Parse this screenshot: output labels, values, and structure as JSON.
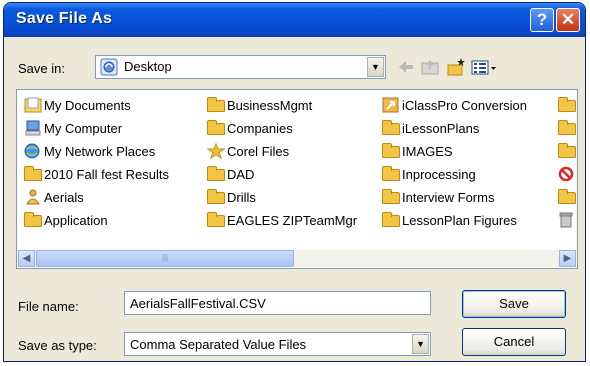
{
  "window": {
    "title": "Save File As",
    "help_glyph": "?",
    "close_glyph": "✕"
  },
  "save_in": {
    "label": "Save in:",
    "value": "Desktop"
  },
  "toolbar": {
    "back_icon": "back-arrow-icon",
    "up_icon": "up-folder-icon",
    "new_folder_icon": "new-folder-icon",
    "view_icon": "view-menu-icon"
  },
  "items": [
    {
      "name": "My Documents",
      "icon": "my-documents-icon"
    },
    {
      "name": "My Computer",
      "icon": "my-computer-icon"
    },
    {
      "name": "My Network Places",
      "icon": "network-places-icon"
    },
    {
      "name": "2010 Fall fest Results",
      "icon": "folder-icon"
    },
    {
      "name": "Aerials",
      "icon": "user-folder-icon"
    },
    {
      "name": "Application",
      "icon": "folder-icon"
    },
    {
      "name": "BusinessMgmt",
      "icon": "folder-icon"
    },
    {
      "name": "Companies",
      "icon": "folder-icon"
    },
    {
      "name": "Corel Files",
      "icon": "star-folder-icon"
    },
    {
      "name": "DAD",
      "icon": "folder-icon"
    },
    {
      "name": "Drills",
      "icon": "folder-icon"
    },
    {
      "name": "EAGLES ZIPTeamMgr",
      "icon": "folder-icon"
    },
    {
      "name": "iClassPro Conversion",
      "icon": "shortcut-icon"
    },
    {
      "name": "iLessonPlans",
      "icon": "folder-icon"
    },
    {
      "name": "IMAGES",
      "icon": "folder-icon"
    },
    {
      "name": "Inprocessing",
      "icon": "folder-icon"
    },
    {
      "name": "Interview Forms",
      "icon": "folder-icon"
    },
    {
      "name": "LessonPlan Figures",
      "icon": "folder-icon"
    }
  ],
  "file_name": {
    "label": "File name:",
    "value": "AerialsFallFestival.CSV"
  },
  "save_as_type": {
    "label": "Save as type:",
    "value": "Comma Separated Value Files"
  },
  "buttons": {
    "save": "Save",
    "cancel": "Cancel"
  },
  "colors": {
    "title_bar": "#0650d8",
    "dialog_bg": "#ece9d8",
    "border": "#7f9db9"
  }
}
